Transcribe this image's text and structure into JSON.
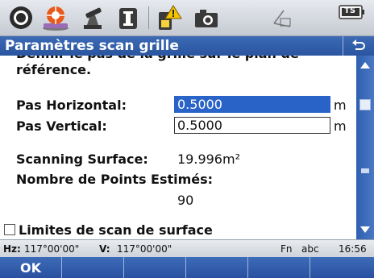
{
  "toolbar": {
    "icons": [
      "satellite-icon",
      "target-prism-icon",
      "instrument-icon",
      "ir-mode-icon",
      "battery-warning-icon",
      "camera-icon",
      "level-bubble-icon",
      "ts-battery-icon"
    ],
    "ts_label": "TS"
  },
  "window": {
    "title": "Paramètres scan grille"
  },
  "content": {
    "intro_line1": "Définir le pas de la grille sur le plan de",
    "intro_line2": "référence.",
    "pas_horizontal": {
      "label": "Pas Horizontal:",
      "value": "0.5000",
      "unit": "m"
    },
    "pas_vertical": {
      "label": "Pas Vertical:",
      "value": "0.5000",
      "unit": "m"
    },
    "scanning_surface": {
      "label": "Scanning Surface:",
      "value": "19.996m²"
    },
    "nombre_points": {
      "label": "Nombre de Points Estimés:",
      "value": "90"
    },
    "limites_checkbox": {
      "label": "Limites de scan de surface",
      "checked": false
    }
  },
  "status": {
    "hz_label": "Hz:",
    "hz_value": "117°00'00\"",
    "v_label": "V:",
    "v_value": "117°00'00\"",
    "fn": "Fn",
    "input_mode": "abc",
    "time": "16:56"
  },
  "softkeys": [
    "OK",
    "",
    "",
    "",
    "",
    ""
  ],
  "colors": {
    "title_bar": "#2a55a0",
    "selected_field": "#2a63c7",
    "scrollbar": "#3a68b8"
  }
}
